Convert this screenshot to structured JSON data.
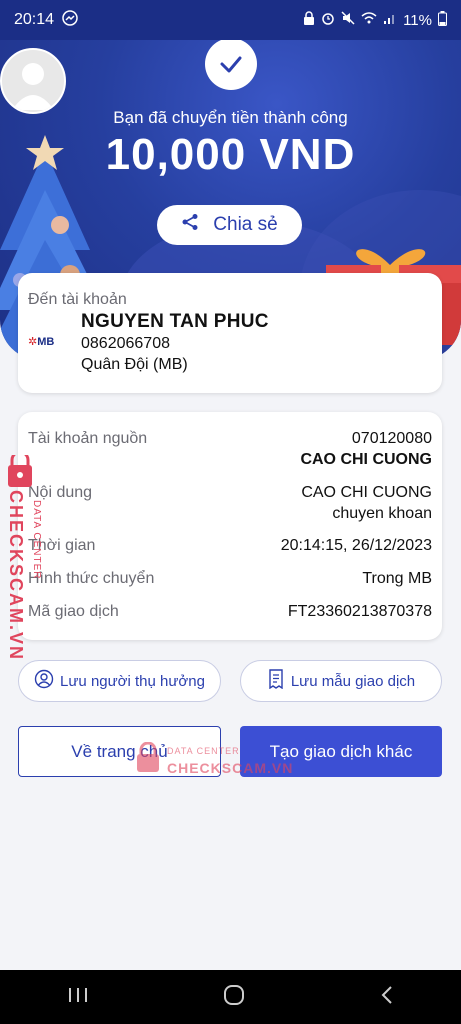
{
  "status_bar": {
    "time": "20:14",
    "battery": "11%"
  },
  "header": {
    "success_message": "Bạn đã chuyển tiền thành công",
    "amount": "10,000 VND",
    "share_label": "Chia sẻ"
  },
  "recipient": {
    "title": "Đến tài khoản",
    "bank_logo": "MB",
    "name": "NGUYEN TAN PHUC",
    "account": "0862066708",
    "bank": "Quân Đội (MB)"
  },
  "details": {
    "source_label": "Tài khoản nguồn",
    "source_account": "070120080",
    "source_name": "CAO CHI CUONG",
    "content_label": "Nội dung",
    "content_line1": "CAO CHI CUONG",
    "content_line2": "chuyen khoan",
    "time_label": "Thời gian",
    "time_value": "20:14:15, 26/12/2023",
    "method_label": "Hình thức chuyển",
    "method_value": "Trong MB",
    "txn_label": "Mã giao dịch",
    "txn_value": "FT23360213870378"
  },
  "actions": {
    "save_beneficiary": "Lưu người thụ hưởng",
    "save_template": "Lưu mẫu giao dịch",
    "home": "Về trang chủ",
    "new_transaction": "Tạo giao dịch khác"
  },
  "watermark": {
    "top": "DATA CENTER",
    "brand": "CHECKSCAM.VN"
  },
  "colors": {
    "primary": "#3c4fd4",
    "header_bg": "#263f9f",
    "text_link": "#2b3fae"
  }
}
